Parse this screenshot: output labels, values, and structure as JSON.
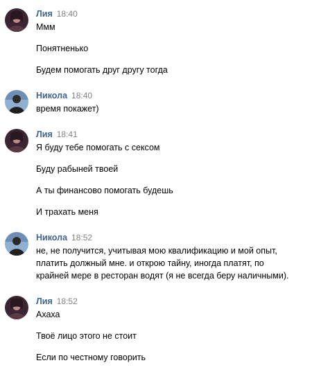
{
  "users": {
    "liya": {
      "name": "Лия",
      "avatar_icon": "female-profile-photo-icon",
      "avatar_colors": [
        "#3a2530",
        "#c28a86"
      ]
    },
    "nikola": {
      "name": "Никола",
      "avatar_icon": "male-profile-photo-icon",
      "avatar_colors": [
        "#6e8fb3",
        "#2a2a2a"
      ]
    }
  },
  "groups": [
    {
      "author": "Лия",
      "time": "18:40",
      "messages": [
        "Ммм",
        "Понятненько",
        "Будем помогать друг другу тогда"
      ]
    },
    {
      "author": "Никола",
      "time": "18:40",
      "messages": [
        "время покажет)"
      ]
    },
    {
      "author": "Лия",
      "time": "18:41",
      "messages": [
        "Я буду тебе помогать с сексом",
        "Буду рабыней твоей",
        "А ты финансово помогать будешь",
        "И трахать меня"
      ]
    },
    {
      "author": "Никола",
      "time": "18:52",
      "messages": [
        "не, не получится, учитывая мою квалификацию и мой опыт,",
        "платить должный мне. и открою тайну, иногда платят, по",
        "крайней мере в ресторан водят (я не всегда беру наличными)."
      ]
    },
    {
      "author": "Лия",
      "time": "18:52",
      "messages": [
        "Ахаха",
        "Твоё лицо этого не стоит",
        "Если по честному говорить"
      ]
    }
  ],
  "colors": {
    "author": "#42648b",
    "time": "#828282",
    "text": "#000000",
    "background": "#ffffff"
  }
}
